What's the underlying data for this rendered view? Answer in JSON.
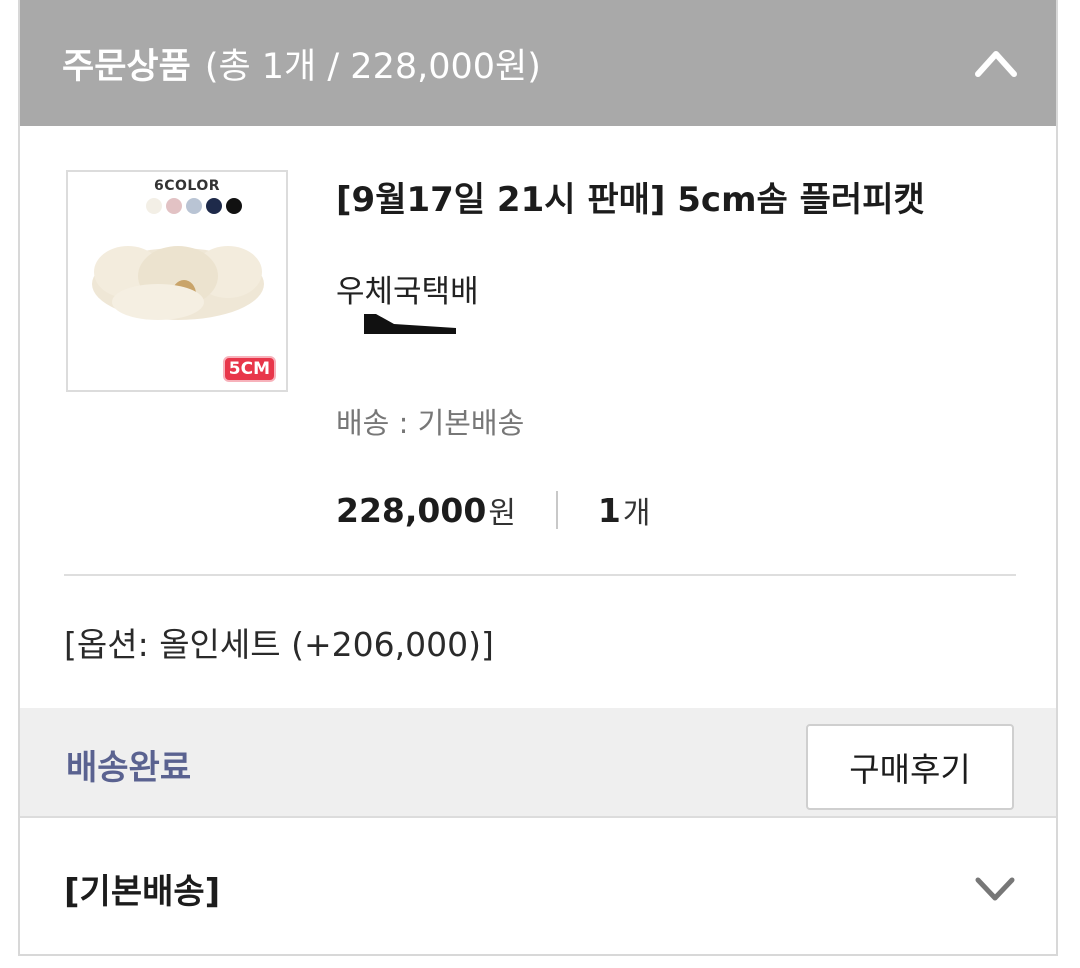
{
  "header": {
    "title": "주문상품",
    "summary": "(총 1개 / 228,000원)",
    "collapse_icon": "chevron-up-icon"
  },
  "product": {
    "thumbnail": {
      "color_label": "6COLOR",
      "size_badge": "5CM",
      "swatches": [
        "#f3efe6",
        "#e2c2c4",
        "#b9c4d4",
        "#1e2a4a",
        "#111111"
      ]
    },
    "name": "[9월17일 21시 판매] 5cm솜 플러피캣",
    "carrier": "우체국택배",
    "shipping": "배송 : 기본배송",
    "price": "228,000",
    "price_unit": "원",
    "quantity": "1",
    "quantity_unit": "개"
  },
  "option": {
    "text": "[옵션: 올인세트 (+206,000)]"
  },
  "status": {
    "label": "배송완료",
    "review_button": "구매후기",
    "label_color": "#5a6290"
  },
  "delivery": {
    "title": "[기본배송]",
    "expand_icon": "chevron-down-icon"
  }
}
